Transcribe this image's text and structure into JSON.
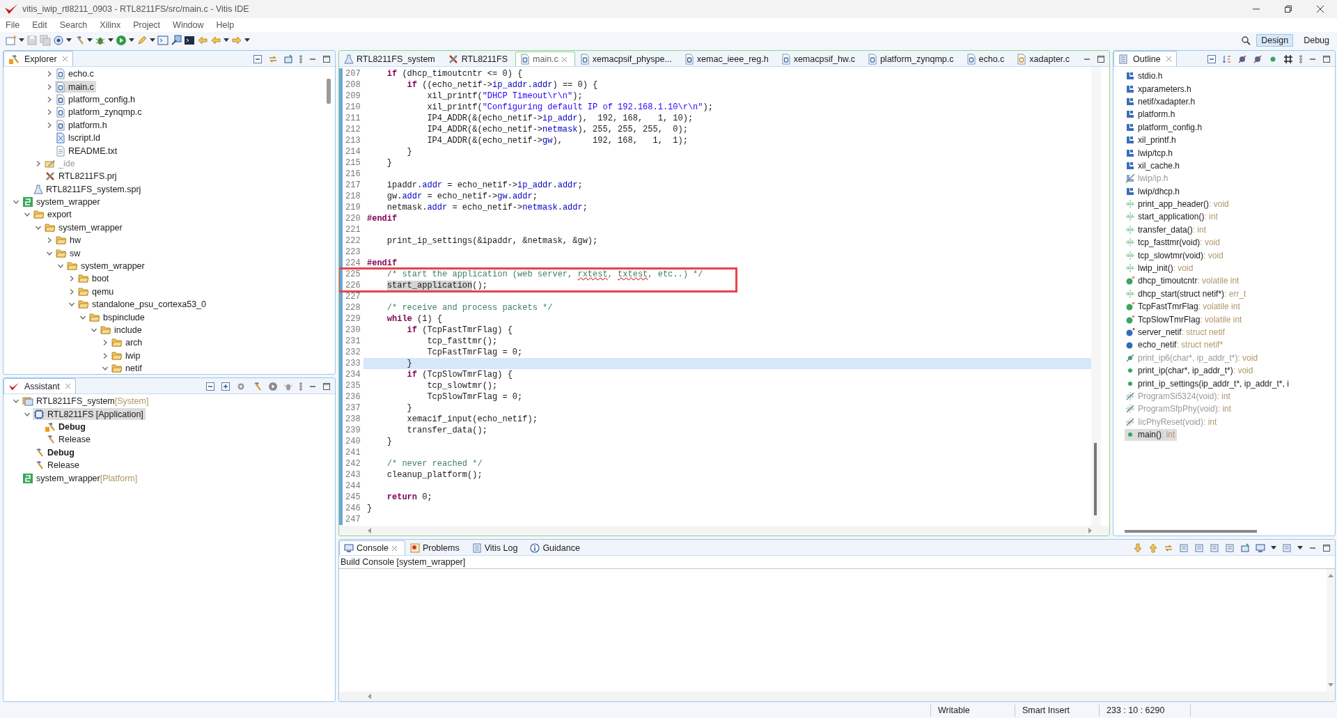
{
  "window": {
    "title": "vitis_iwip_rtl8211_0903 - RTL8211FS/src/main.c - Vitis IDE"
  },
  "menu": [
    "File",
    "Edit",
    "Search",
    "Xilinx",
    "Project",
    "Window",
    "Help"
  ],
  "perspectives": [
    {
      "label": "Design",
      "selected": true
    },
    {
      "label": "Debug",
      "selected": false
    }
  ],
  "explorer": {
    "title": "Explorer",
    "items": [
      {
        "children": [
          {
            "children": [
              {
                "children": [
                  {
                    "label": "echo.c",
                    "kind": "c",
                    "expanded": false,
                    "selected": false
                  },
                  {
                    "label": "main.c",
                    "kind": "c",
                    "expanded": false,
                    "selected": true
                  },
                  {
                    "label": "platform_config.h",
                    "kind": "h",
                    "expanded": false,
                    "selected": false
                  },
                  {
                    "label": "platform_zynqmp.c",
                    "kind": "c",
                    "expanded": false,
                    "selected": false
                  },
                  {
                    "label": "platform.h",
                    "kind": "h",
                    "expanded": false,
                    "selected": false
                  },
                  {
                    "label": "lscript.ld",
                    "kind": "ld",
                    "selected": false
                  },
                  {
                    "label": "README.txt",
                    "kind": "txt",
                    "selected": false
                  }
                ]
              },
              {
                "label": "_ide",
                "kind": "ide",
                "expanded": false,
                "selected": false
              },
              {
                "label": "RTL8211FS.prj",
                "kind": "prj",
                "selected": false
              }
            ]
          },
          {
            "label": "RTL8211FS_system.sprj",
            "kind": "sprj",
            "selected": false
          }
        ]
      },
      {
        "label": "system_wrapper",
        "kind": "platform",
        "expanded": true,
        "selected": false,
        "children": [
          {
            "label": "export",
            "kind": "folder",
            "expanded": true,
            "selected": false,
            "children": [
              {
                "label": "system_wrapper",
                "kind": "folder",
                "expanded": true,
                "selected": false,
                "children": [
                  {
                    "label": "hw",
                    "kind": "folder",
                    "expanded": false,
                    "selected": false
                  },
                  {
                    "label": "sw",
                    "kind": "folder",
                    "expanded": true,
                    "selected": false,
                    "children": [
                      {
                        "label": "system_wrapper",
                        "kind": "folder",
                        "expanded": true,
                        "selected": false,
                        "children": [
                          {
                            "label": "boot",
                            "kind": "folder",
                            "expanded": false,
                            "selected": false
                          },
                          {
                            "label": "qemu",
                            "kind": "folder",
                            "expanded": false,
                            "selected": false
                          },
                          {
                            "label": "standalone_psu_cortexa53_0",
                            "kind": "folder",
                            "expanded": true,
                            "selected": false,
                            "children": [
                              {
                                "label": "bspinclude",
                                "kind": "folder",
                                "expanded": true,
                                "selected": false,
                                "children": [
                                  {
                                    "label": "include",
                                    "kind": "folder",
                                    "expanded": true,
                                    "selected": false,
                                    "children": [
                                      {
                                        "label": "arch",
                                        "kind": "folder",
                                        "expanded": false,
                                        "selected": false
                                      },
                                      {
                                        "label": "lwip",
                                        "kind": "folder",
                                        "expanded": false,
                                        "selected": false
                                      },
                                      {
                                        "label": "netif",
                                        "kind": "folder",
                                        "expanded": true,
                                        "selected": false
                                      }
                                    ]
                                  }
                                ]
                              }
                            ]
                          }
                        ]
                      }
                    ]
                  }
                ]
              }
            ]
          }
        ]
      }
    ]
  },
  "assistant": {
    "title": "Assistant",
    "items": [
      {
        "label": "RTL8211FS_system",
        "tag": "[System]",
        "kind": "system",
        "expanded": true,
        "selected": false,
        "children": [
          {
            "label": "RTL8211FS [Application]",
            "kind": "app",
            "expanded": true,
            "selected": true,
            "children": [
              {
                "label": "Debug",
                "kind": "build-active",
                "active": true,
                "selected": false
              },
              {
                "label": "Release",
                "kind": "build",
                "active": false,
                "selected": false
              }
            ]
          },
          {
            "label": "Debug",
            "kind": "build",
            "active": true,
            "selected": false
          },
          {
            "label": "Release",
            "kind": "build",
            "active": false,
            "selected": false
          }
        ]
      },
      {
        "label": "system_wrapper",
        "tag": "[Platform]",
        "kind": "platform",
        "selected": false
      }
    ]
  },
  "editor": {
    "tabs": [
      {
        "label": "RTL8211FS_system",
        "kind": "sprj",
        "selected": false
      },
      {
        "label": "RTL8211FS",
        "kind": "prj",
        "selected": false
      },
      {
        "label": "main.c",
        "kind": "c",
        "selected": true
      },
      {
        "label": "xemacpsif_physpe...",
        "kind": "c",
        "selected": false
      },
      {
        "label": "xemac_ieee_reg.h",
        "kind": "h",
        "selected": false
      },
      {
        "label": "xemacpsif_hw.c",
        "kind": "c",
        "selected": false
      },
      {
        "label": "platform_zynqmp.c",
        "kind": "c",
        "selected": false
      },
      {
        "label": "echo.c",
        "kind": "c",
        "selected": false
      },
      {
        "label": "xadapter.c",
        "kind": "cw",
        "selected": false
      }
    ],
    "lines": [
      {
        "num": "207",
        "current": false,
        "boxed": false,
        "segs": [
          {
            "kind": "k",
            "text": "    if"
          },
          {
            "kind": "p",
            "text": " (dhcp_timoutcntr <= 0) {"
          }
        ]
      },
      {
        "num": "208",
        "current": false,
        "boxed": false,
        "segs": [
          {
            "kind": "k",
            "text": "        if"
          },
          {
            "kind": "p",
            "text": " ((echo_netif->"
          },
          {
            "kind": "f",
            "text": "ip_addr"
          },
          {
            "kind": "p",
            "text": "."
          },
          {
            "kind": "f",
            "text": "addr"
          },
          {
            "kind": "p",
            "text": ") == 0) {"
          }
        ]
      },
      {
        "num": "209",
        "current": false,
        "boxed": false,
        "segs": [
          {
            "kind": "p",
            "text": "            xil_printf("
          },
          {
            "kind": "s",
            "text": "\"DHCP Timeout\\r\\n\""
          },
          {
            "kind": "p",
            "text": ");"
          }
        ]
      },
      {
        "num": "210",
        "current": false,
        "boxed": false,
        "segs": [
          {
            "kind": "p",
            "text": "            xil_printf("
          },
          {
            "kind": "s",
            "text": "\"Configuring default IP of 192.168.1.10\\r\\n\""
          },
          {
            "kind": "p",
            "text": ");"
          }
        ]
      },
      {
        "num": "211",
        "current": false,
        "boxed": false,
        "segs": [
          {
            "kind": "p",
            "text": "            IP4_ADDR(&(echo_netif->"
          },
          {
            "kind": "f",
            "text": "ip_addr"
          },
          {
            "kind": "p",
            "text": "),  192, 168,   1, 10);"
          }
        ]
      },
      {
        "num": "212",
        "current": false,
        "boxed": false,
        "segs": [
          {
            "kind": "p",
            "text": "            IP4_ADDR(&(echo_netif->"
          },
          {
            "kind": "f",
            "text": "netmask"
          },
          {
            "kind": "p",
            "text": "), 255, 255, 255,  0);"
          }
        ]
      },
      {
        "num": "213",
        "current": false,
        "boxed": false,
        "segs": [
          {
            "kind": "p",
            "text": "            IP4_ADDR(&(echo_netif->"
          },
          {
            "kind": "f",
            "text": "gw"
          },
          {
            "kind": "p",
            "text": "),      192, 168,   1,  1);"
          }
        ]
      },
      {
        "num": "214",
        "current": false,
        "boxed": false,
        "segs": [
          {
            "kind": "p",
            "text": "        }"
          }
        ]
      },
      {
        "num": "215",
        "current": false,
        "boxed": false,
        "segs": [
          {
            "kind": "p",
            "text": "    }"
          }
        ]
      },
      {
        "num": "216",
        "current": false,
        "boxed": false
      },
      {
        "num": "217",
        "current": false,
        "boxed": false,
        "segs": [
          {
            "kind": "p",
            "text": "    ipaddr."
          },
          {
            "kind": "f",
            "text": "addr"
          },
          {
            "kind": "p",
            "text": " = echo_netif->"
          },
          {
            "kind": "f",
            "text": "ip_addr"
          },
          {
            "kind": "p",
            "text": "."
          },
          {
            "kind": "f",
            "text": "addr"
          },
          {
            "kind": "p",
            "text": ";"
          }
        ]
      },
      {
        "num": "218",
        "current": false,
        "boxed": false,
        "segs": [
          {
            "kind": "p",
            "text": "    gw."
          },
          {
            "kind": "f",
            "text": "addr"
          },
          {
            "kind": "p",
            "text": " = echo_netif->"
          },
          {
            "kind": "f",
            "text": "gw"
          },
          {
            "kind": "p",
            "text": "."
          },
          {
            "kind": "f",
            "text": "addr"
          },
          {
            "kind": "p",
            "text": ";"
          }
        ]
      },
      {
        "num": "219",
        "current": false,
        "boxed": false,
        "segs": [
          {
            "kind": "p",
            "text": "    netmask."
          },
          {
            "kind": "f",
            "text": "addr"
          },
          {
            "kind": "p",
            "text": " = echo_netif->"
          },
          {
            "kind": "f",
            "text": "netmask"
          },
          {
            "kind": "p",
            "text": "."
          },
          {
            "kind": "f",
            "text": "addr"
          },
          {
            "kind": "p",
            "text": ";"
          }
        ]
      },
      {
        "num": "220",
        "current": false,
        "boxed": false,
        "segs": [
          {
            "kind": "m",
            "text": "#endif"
          }
        ]
      },
      {
        "num": "221",
        "current": false,
        "boxed": false
      },
      {
        "num": "222",
        "current": false,
        "boxed": false,
        "segs": [
          {
            "kind": "p",
            "text": "    print_ip_settings(&ipaddr, &netmask, &gw);"
          }
        ]
      },
      {
        "num": "223",
        "current": false,
        "boxed": false
      },
      {
        "num": "224",
        "current": false,
        "boxed": false,
        "segs": [
          {
            "kind": "m",
            "text": "#endif"
          }
        ]
      },
      {
        "num": "225",
        "current": false,
        "boxed": true,
        "segs": [
          {
            "kind": "c",
            "text": "    /* start the application (web server, "
          },
          {
            "kind": "w",
            "text": "rxtest"
          },
          {
            "kind": "c",
            "text": ", "
          },
          {
            "kind": "w",
            "text": "txtest"
          },
          {
            "kind": "c",
            "text": ", etc..) */"
          }
        ]
      },
      {
        "num": "226",
        "current": false,
        "boxed": true,
        "segs": [
          {
            "kind": "o",
            "text": "    start_application"
          },
          {
            "kind": "p",
            "text": "();"
          }
        ]
      },
      {
        "num": "227",
        "current": false,
        "boxed": false
      },
      {
        "num": "228",
        "current": false,
        "boxed": false,
        "segs": [
          {
            "kind": "c",
            "text": "    /* receive and process packets */"
          }
        ]
      },
      {
        "num": "229",
        "current": false,
        "boxed": false,
        "segs": [
          {
            "kind": "k",
            "text": "    while"
          },
          {
            "kind": "p",
            "text": " (1) {"
          }
        ]
      },
      {
        "num": "230",
        "current": false,
        "boxed": false,
        "segs": [
          {
            "kind": "k",
            "text": "        if"
          },
          {
            "kind": "p",
            "text": " (TcpFastTmrFlag) {"
          }
        ]
      },
      {
        "num": "231",
        "current": false,
        "boxed": false,
        "segs": [
          {
            "kind": "p",
            "text": "            tcp_fasttmr();"
          }
        ]
      },
      {
        "num": "232",
        "current": false,
        "boxed": false,
        "segs": [
          {
            "kind": "p",
            "text": "            TcpFastTmrFlag = 0;"
          }
        ]
      },
      {
        "num": "233",
        "current": true,
        "boxed": false,
        "segs": [
          {
            "kind": "p",
            "text": "        }"
          }
        ]
      },
      {
        "num": "234",
        "current": false,
        "boxed": false,
        "segs": [
          {
            "kind": "k",
            "text": "        if"
          },
          {
            "kind": "p",
            "text": " (TcpSlowTmrFlag) {"
          }
        ]
      },
      {
        "num": "235",
        "current": false,
        "boxed": false,
        "segs": [
          {
            "kind": "p",
            "text": "            tcp_slowtmr();"
          }
        ]
      },
      {
        "num": "236",
        "current": false,
        "boxed": false,
        "segs": [
          {
            "kind": "p",
            "text": "            TcpSlowTmrFlag = 0;"
          }
        ]
      },
      {
        "num": "237",
        "current": false,
        "boxed": false,
        "segs": [
          {
            "kind": "p",
            "text": "        }"
          }
        ]
      },
      {
        "num": "238",
        "current": false,
        "boxed": false,
        "segs": [
          {
            "kind": "p",
            "text": "        xemacif_input(echo_netif);"
          }
        ]
      },
      {
        "num": "239",
        "current": false,
        "boxed": false,
        "segs": [
          {
            "kind": "p",
            "text": "        transfer_data();"
          }
        ]
      },
      {
        "num": "240",
        "current": false,
        "boxed": false,
        "segs": [
          {
            "kind": "p",
            "text": "    }"
          }
        ]
      },
      {
        "num": "241",
        "current": false,
        "boxed": false
      },
      {
        "num": "242",
        "current": false,
        "boxed": false,
        "segs": [
          {
            "kind": "c",
            "text": "    /* never reached */"
          }
        ]
      },
      {
        "num": "243",
        "current": false,
        "boxed": false,
        "segs": [
          {
            "kind": "p",
            "text": "    cleanup_platform();"
          }
        ]
      },
      {
        "num": "244",
        "current": false,
        "boxed": false
      },
      {
        "num": "245",
        "current": false,
        "boxed": false,
        "segs": [
          {
            "kind": "k",
            "text": "    return"
          },
          {
            "kind": "p",
            "text": " 0;"
          }
        ]
      },
      {
        "num": "246",
        "current": false,
        "boxed": false,
        "segs": [
          {
            "kind": "p",
            "text": "}"
          }
        ]
      },
      {
        "num": "247",
        "current": false,
        "boxed": false
      }
    ]
  },
  "outline": {
    "title": "Outline",
    "items": [
      {
        "label": "stdio.h",
        "kind": "inc",
        "selected": false
      },
      {
        "label": "xparameters.h",
        "kind": "inc",
        "selected": false
      },
      {
        "label": "netif/xadapter.h",
        "kind": "inc",
        "selected": false
      },
      {
        "label": "platform.h",
        "kind": "inc",
        "selected": false
      },
      {
        "label": "platform_config.h",
        "kind": "inc",
        "selected": false
      },
      {
        "label": "xil_printf.h",
        "kind": "inc",
        "selected": false
      },
      {
        "label": "lwip/tcp.h",
        "kind": "inc",
        "selected": false
      },
      {
        "label": "xil_cache.h",
        "kind": "inc",
        "selected": false
      },
      {
        "label": "lwip/ip.h",
        "kind": "inc-off",
        "selected": false
      },
      {
        "label": "lwip/dhcp.h",
        "kind": "inc",
        "selected": false
      },
      {
        "label": "print_app_header()",
        "type": ": void",
        "kind": "decl",
        "selected": false
      },
      {
        "label": "start_application()",
        "type": ": int",
        "kind": "decl",
        "selected": false
      },
      {
        "label": "transfer_data()",
        "type": ": int",
        "kind": "decl",
        "selected": false
      },
      {
        "label": "tcp_fasttmr(void)",
        "type": ": void",
        "kind": "decl",
        "selected": false
      },
      {
        "label": "tcp_slowtmr(void)",
        "type": ": void",
        "kind": "decl",
        "selected": false
      },
      {
        "label": "lwip_init()",
        "type": ": void",
        "kind": "decl",
        "selected": false
      },
      {
        "label": "dhcp_timoutcntr",
        "type": ": volatile int",
        "kind": "var-v",
        "selected": false
      },
      {
        "label": "dhcp_start(struct netif*)",
        "type": ": err_t",
        "kind": "decl",
        "selected": false
      },
      {
        "label": "TcpFastTmrFlag",
        "type": ": volatile int",
        "kind": "var-v",
        "selected": false
      },
      {
        "label": "TcpSlowTmrFlag",
        "type": ": volatile int",
        "kind": "var-v",
        "selected": false
      },
      {
        "label": "server_netif",
        "type": ": struct netif",
        "kind": "var-s",
        "selected": false
      },
      {
        "label": "echo_netif",
        "type": ": struct netif*",
        "kind": "var",
        "selected": false
      },
      {
        "label": "print_ip6(char*, ip_addr_t*)",
        "type": ": void",
        "kind": "fn-off",
        "selected": false
      },
      {
        "label": "print_ip(char*, ip_addr_t*)",
        "type": ": void",
        "kind": "fn",
        "selected": false
      },
      {
        "label": "print_ip_settings(ip_addr_t*, ip_addr_t*, i",
        "kind": "fn",
        "selected": false
      },
      {
        "label": "ProgramSi5324(void)",
        "type": ": int",
        "kind": "fn-x",
        "selected": false
      },
      {
        "label": "ProgramSfpPhy(void)",
        "type": ": int",
        "kind": "fn-x",
        "selected": false
      },
      {
        "label": "IicPhyReset(void)",
        "type": ": int",
        "kind": "fn-x",
        "selected": false
      },
      {
        "label": "main()",
        "type": ": int",
        "kind": "fn",
        "selected": true
      }
    ]
  },
  "console": {
    "tabs": [
      {
        "label": "Console",
        "kind": "console",
        "selected": true
      },
      {
        "label": "Problems",
        "kind": "problems",
        "selected": false
      },
      {
        "label": "Vitis Log",
        "kind": "log",
        "selected": false
      },
      {
        "label": "Guidance",
        "kind": "info",
        "selected": false
      }
    ],
    "name": "Build Console [system_wrapper]"
  },
  "status_bar": [
    "Writable",
    "Smart Insert",
    "233 : 10 : 6290"
  ]
}
